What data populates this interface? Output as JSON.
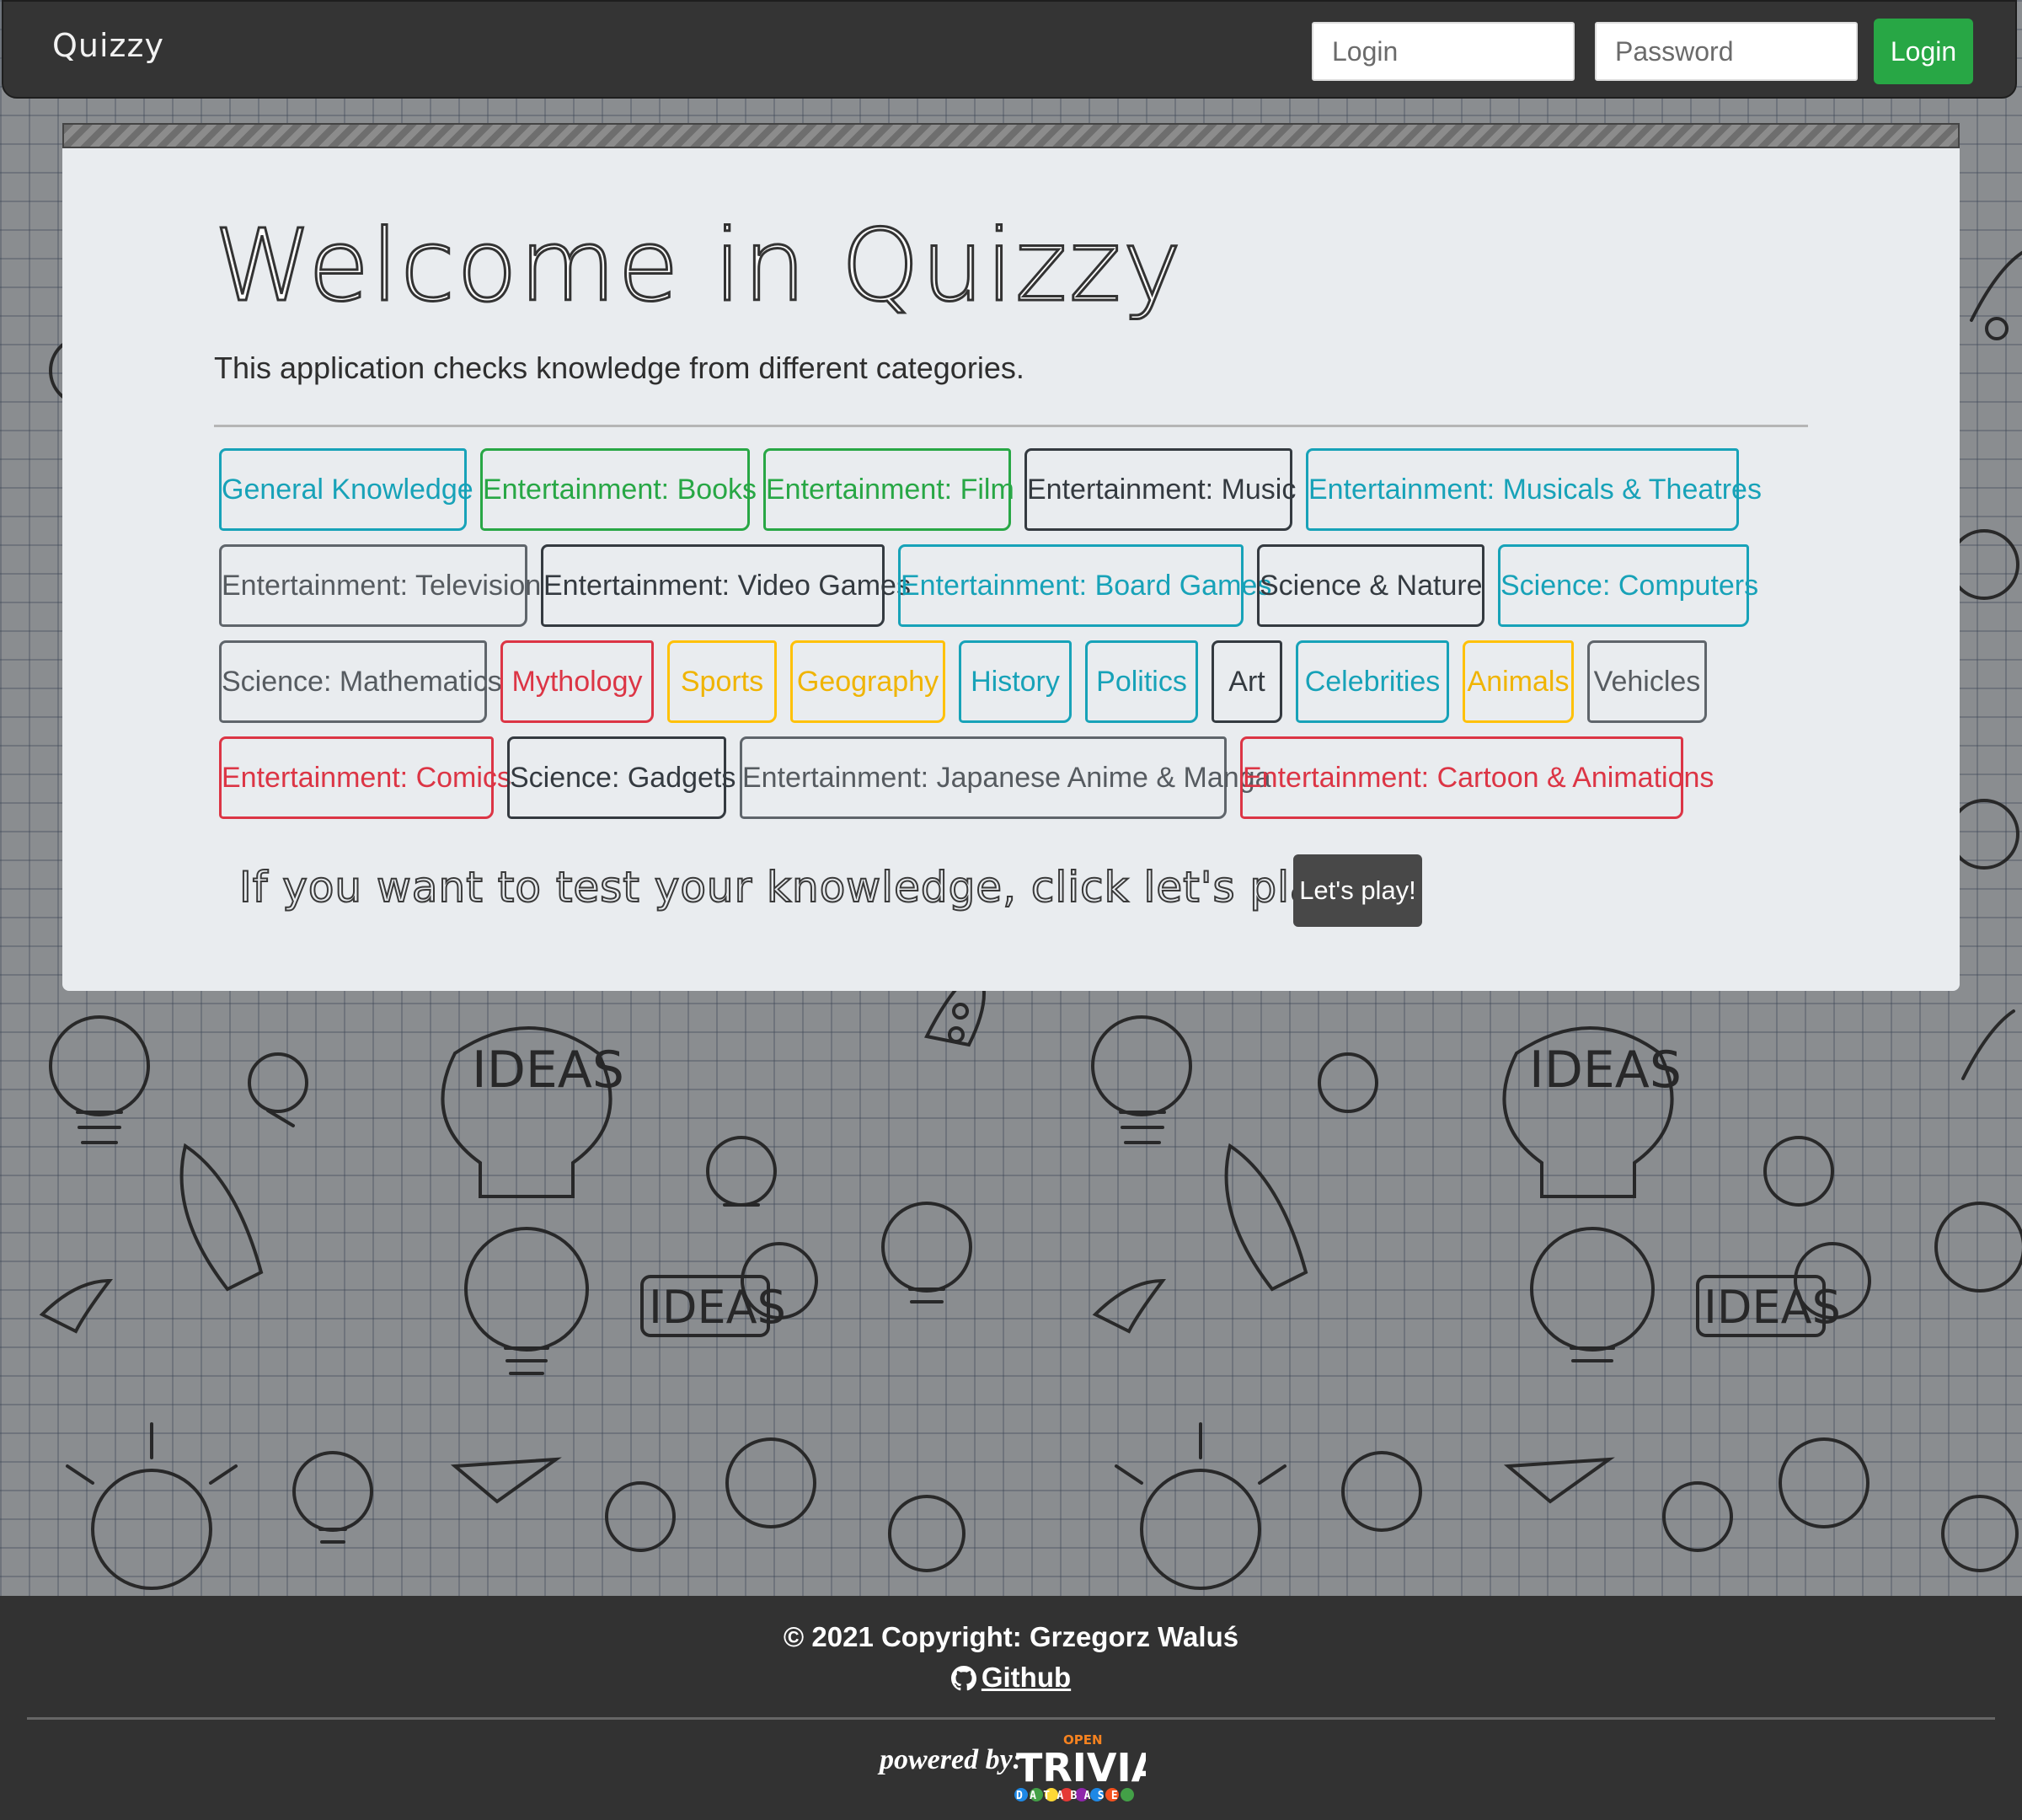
{
  "navbar": {
    "brand": "Quizzy",
    "login_placeholder": "Login",
    "password_placeholder": "Password",
    "login_button": "Login"
  },
  "jumbotron": {
    "title": "Welcome in Quizzy",
    "lead": "This application checks knowledge from different categories.",
    "categories": [
      {
        "label": "General Knowledge",
        "style": "info"
      },
      {
        "label": "Entertainment: Books",
        "style": "success"
      },
      {
        "label": "Entertainment: Film",
        "style": "success"
      },
      {
        "label": "Entertainment: Music",
        "style": "dark"
      },
      {
        "label": "Entertainment: Musicals & Theatres",
        "style": "info"
      },
      {
        "label": "Entertainment: Television",
        "style": "secondary"
      },
      {
        "label": "Entertainment: Video Games",
        "style": "dark"
      },
      {
        "label": "Entertainment: Board Games",
        "style": "info"
      },
      {
        "label": "Science & Nature",
        "style": "dark"
      },
      {
        "label": "Science: Computers",
        "style": "info"
      },
      {
        "label": "Science: Mathematics",
        "style": "secondary"
      },
      {
        "label": "Mythology",
        "style": "danger"
      },
      {
        "label": "Sports",
        "style": "warning"
      },
      {
        "label": "Geography",
        "style": "warning"
      },
      {
        "label": "History",
        "style": "info"
      },
      {
        "label": "Politics",
        "style": "info"
      },
      {
        "label": "Art",
        "style": "dark"
      },
      {
        "label": "Celebrities",
        "style": "info"
      },
      {
        "label": "Animals",
        "style": "warning"
      },
      {
        "label": "Vehicles",
        "style": "secondary"
      },
      {
        "label": "Entertainment: Comics",
        "style": "danger"
      },
      {
        "label": "Science: Gadgets",
        "style": "dark"
      },
      {
        "label": "Entertainment: Japanese Anime & Manga",
        "style": "secondary"
      },
      {
        "label": "Entertainment: Cartoon & Animations",
        "style": "danger"
      }
    ],
    "play_text": "If you want to test your knowledge, click let's play.",
    "play_button": "Let's play!"
  },
  "footer": {
    "copyright": "© 2021 Copyright: Grzegorz Waluś",
    "github": "Github",
    "powered_by": "powered by:",
    "logo": {
      "top": "OPEN",
      "main": "TRIVIA",
      "bottom": "DATABASE"
    }
  },
  "colors": {
    "navbar": "#343434",
    "success": "#28a745",
    "info": "#17a2b8",
    "danger": "#dc3545",
    "warning": "#ffc107",
    "dark": "#343a40",
    "jumbotron": "#e9ecef",
    "footer": "#323232"
  }
}
